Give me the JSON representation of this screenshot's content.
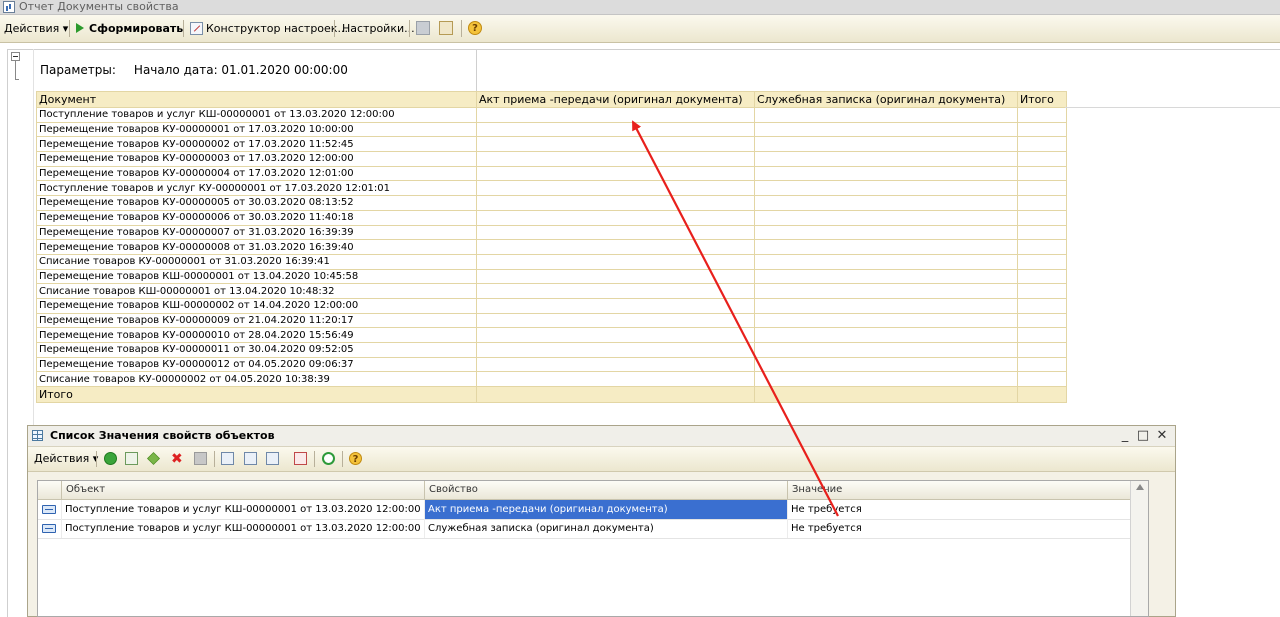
{
  "window": {
    "title": "Отчет  Документы свойства"
  },
  "toolbar": {
    "actions_label": "Действия ▾",
    "generate_label": "Сформировать",
    "constructor_label": "Конструктор настроек...",
    "settings_label": "Настройки...",
    "help_label": "?"
  },
  "report": {
    "params_label": "Параметры:",
    "params_value": "Начало дата: 01.01.2020 00:00:00",
    "headers": [
      "Документ",
      "Акт приема -передачи (оригинал документа)",
      "Служебная записка (оригинал документа)",
      "Итого"
    ],
    "rows": [
      "Поступление товаров и услуг КШ-00000001 от 13.03.2020 12:00:00",
      "Перемещение товаров КУ-00000001 от 17.03.2020 10:00:00",
      "Перемещение товаров КУ-00000002 от 17.03.2020 11:52:45",
      "Перемещение товаров КУ-00000003 от 17.03.2020 12:00:00",
      "Перемещение товаров КУ-00000004 от 17.03.2020 12:01:00",
      "Поступление товаров и услуг КУ-00000001 от 17.03.2020 12:01:01",
      "Перемещение товаров КУ-00000005 от 30.03.2020 08:13:52",
      "Перемещение товаров КУ-00000006 от 30.03.2020 11:40:18",
      "Перемещение товаров КУ-00000007 от 31.03.2020 16:39:39",
      "Перемещение товаров КУ-00000008 от 31.03.2020 16:39:40",
      "Списание товаров КУ-00000001 от 31.03.2020 16:39:41",
      "Перемещение товаров КШ-00000001 от 13.04.2020 10:45:58",
      "Списание товаров КШ-00000001 от 13.04.2020 10:48:32",
      "Перемещение товаров КШ-00000002 от 14.04.2020 12:00:00",
      "Перемещение товаров КУ-00000009 от 21.04.2020 11:20:17",
      "Перемещение товаров КУ-00000010 от 28.04.2020 15:56:49",
      "Перемещение товаров КУ-00000011 от 30.04.2020 09:52:05",
      "Перемещение товаров КУ-00000012 от 04.05.2020 09:06:37",
      "Списание товаров КУ-00000002 от 04.05.2020 10:38:39"
    ],
    "total_label": "Итого"
  },
  "list_window": {
    "title": "Список Значения свойств объектов",
    "actions_label": "Действия ▾",
    "help_label": "?",
    "columns": [
      "Объект",
      "Свойство",
      "Значение"
    ],
    "rows": [
      {
        "object": "Поступление товаров и услуг КШ-00000001 от 13.03.2020 12:00:00",
        "property": "Акт приема -передачи (оригинал документа)",
        "value": "Не требуется"
      },
      {
        "object": "Поступление товаров и услуг КШ-00000001 от 13.03.2020 12:00:00",
        "property": "Служебная записка (оригинал документа)",
        "value": "Не требуется"
      }
    ],
    "minimize": "_",
    "maximize": "□",
    "close": "✕"
  },
  "colors": {
    "accent_arrow": "#e8201c",
    "selection": "#3a6fd0",
    "report_header": "#f6ecc4"
  }
}
